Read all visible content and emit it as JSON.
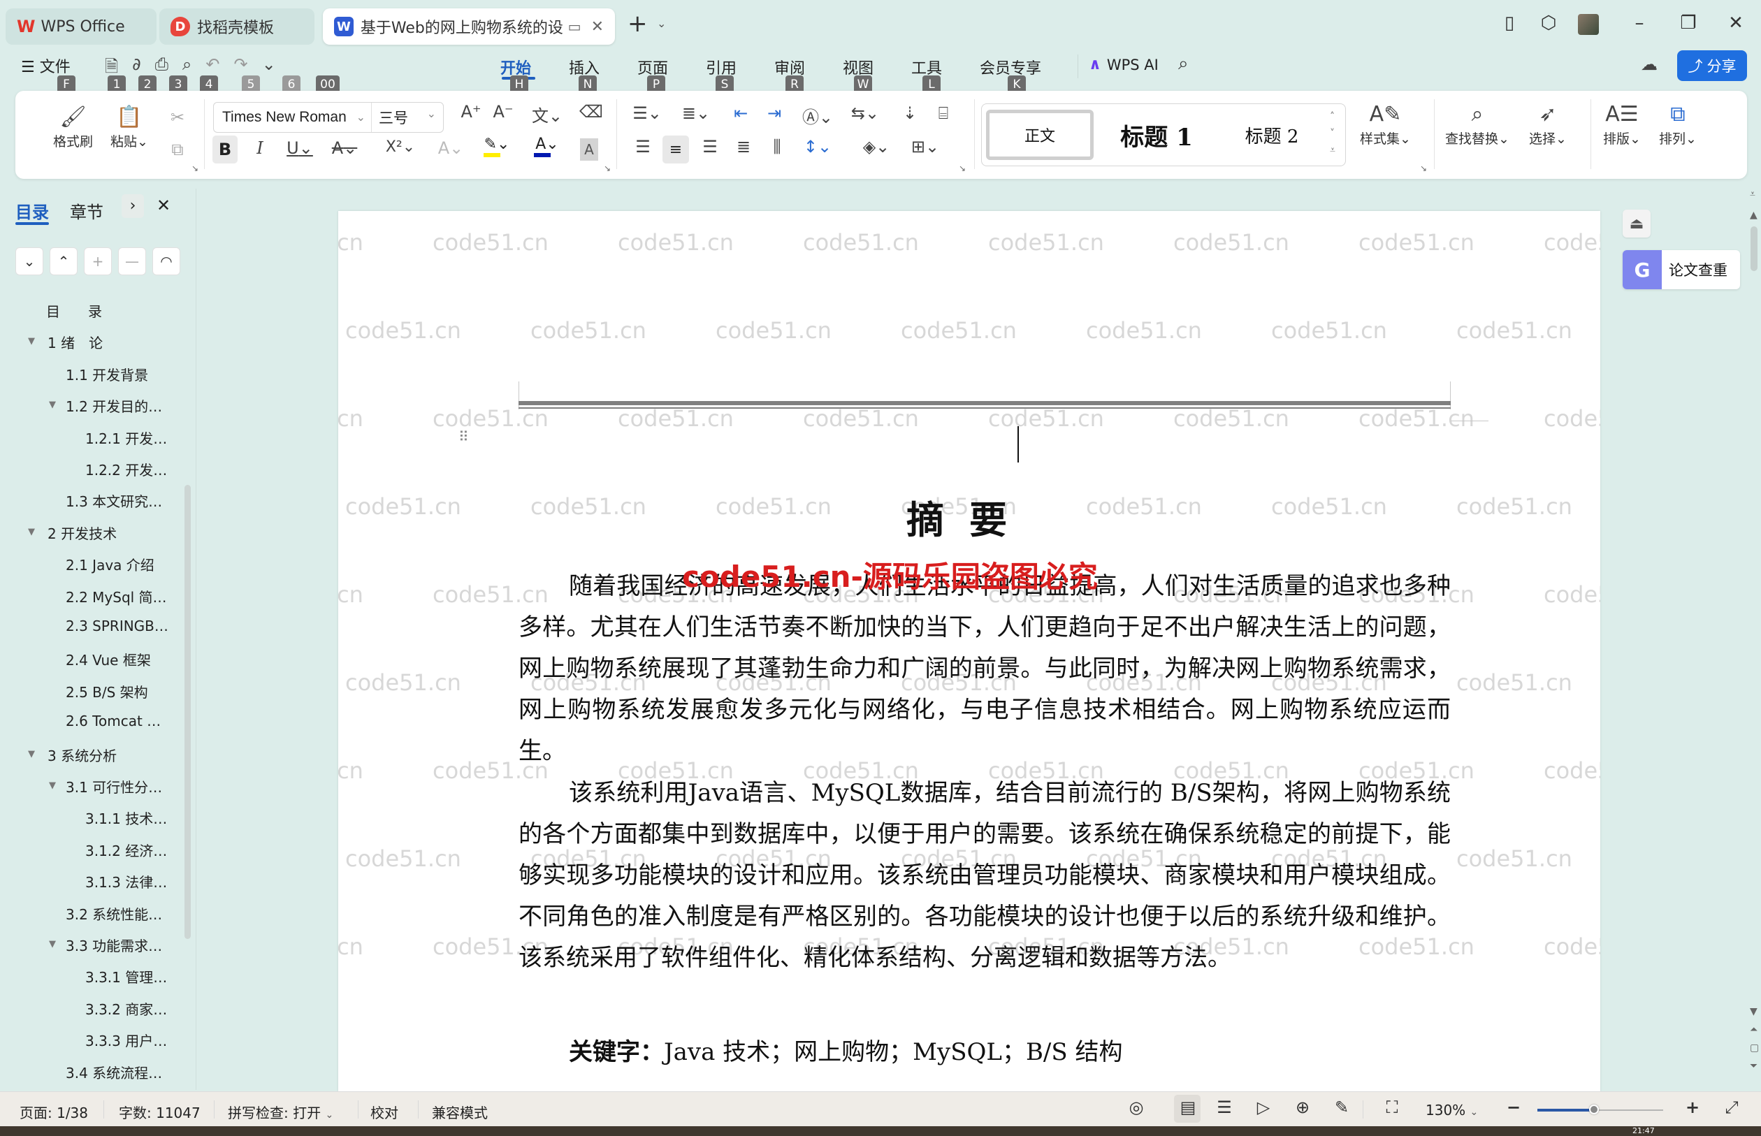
{
  "window": {
    "tabs": [
      {
        "label": "WPS Office",
        "icon": "wps-logo-icon",
        "state": "inactive"
      },
      {
        "label": "找稻壳模板",
        "icon": "docer-logo-icon",
        "state": "inactive"
      },
      {
        "label": "基于Web的网上购物系统的设计",
        "icon": "writer-doc-icon",
        "state": "active"
      }
    ],
    "new_tab_label": "+",
    "controls": [
      "layout-icon",
      "cube-icon",
      "avatar",
      "minimize-icon",
      "restore-icon",
      "close-icon"
    ]
  },
  "menu": {
    "file_label": "文件",
    "file_keytip": "F",
    "quick_keytips": [
      "1",
      "2",
      "3",
      "4",
      "5",
      "6",
      "00"
    ],
    "tabs": [
      {
        "label": "开始",
        "keytip": "H",
        "active": true
      },
      {
        "label": "插入",
        "keytip": "N"
      },
      {
        "label": "页面",
        "keytip": "P"
      },
      {
        "label": "引用",
        "keytip": "S"
      },
      {
        "label": "审阅",
        "keytip": "R"
      },
      {
        "label": "视图",
        "keytip": "W"
      },
      {
        "label": "工具",
        "keytip": "L"
      },
      {
        "label": "会员专享",
        "keytip": "K"
      }
    ],
    "wps_ai_label": "WPS AI",
    "share_label": "分享"
  },
  "ribbon": {
    "format_painter": "格式刷",
    "paste": "粘贴",
    "font_name": "Times New Roman",
    "font_size": "三号",
    "styles": [
      "正文",
      "标题 1",
      "标题 2"
    ],
    "style_set": "样式集",
    "find_replace": "查找替换",
    "select": "选择",
    "layout": "排版",
    "arrange": "排列",
    "bold": "B",
    "italic": "I",
    "underline": "U",
    "strike": "A",
    "superscript": "X²",
    "highlight_color": "#ffee00",
    "font_color": "#0018b0"
  },
  "sidebar": {
    "tabs": [
      {
        "label": "目录",
        "active": true
      },
      {
        "label": "章节"
      }
    ],
    "toc": [
      {
        "label": "目　　录",
        "level": 0,
        "caret": false
      },
      {
        "label": "1 绪　论",
        "level": 0,
        "caret": true
      },
      {
        "label": "1.1 开发背景",
        "level": 1,
        "caret": false
      },
      {
        "label": "1.2 开发目的…",
        "level": 1,
        "caret": true
      },
      {
        "label": "1.2.1 开发…",
        "level": 2,
        "caret": false
      },
      {
        "label": "1.2.2 开发…",
        "level": 2,
        "caret": false
      },
      {
        "label": "1.3 本文研究…",
        "level": 1,
        "caret": false
      },
      {
        "label": "2 开发技术",
        "level": 0,
        "caret": true
      },
      {
        "label": "2.1 Java 介绍",
        "level": 1,
        "caret": false
      },
      {
        "label": "2.2 MySql 简…",
        "level": 1,
        "caret": false
      },
      {
        "label": "2.3 SPRINGB…",
        "level": 1,
        "caret": false
      },
      {
        "label": "2.4 Vue 框架",
        "level": 1,
        "caret": false
      },
      {
        "label": "2.5 B/S 架构",
        "level": 1,
        "caret": false
      },
      {
        "label": "2.6 Tomcat …",
        "level": 1,
        "caret": false
      },
      {
        "label": "3 系统分析",
        "level": 0,
        "caret": true
      },
      {
        "label": "3.1 可行性分…",
        "level": 1,
        "caret": true
      },
      {
        "label": "3.1.1 技术…",
        "level": 2,
        "caret": false
      },
      {
        "label": "3.1.2 经济…",
        "level": 2,
        "caret": false
      },
      {
        "label": "3.1.3 法律…",
        "level": 2,
        "caret": false
      },
      {
        "label": "3.2 系统性能…",
        "level": 1,
        "caret": false
      },
      {
        "label": "3.3 功能需求…",
        "level": 1,
        "caret": true
      },
      {
        "label": "3.3.1 管理…",
        "level": 2,
        "caret": false
      },
      {
        "label": "3.3.2 商家…",
        "level": 2,
        "caret": false
      },
      {
        "label": "3.3.3 用户…",
        "level": 2,
        "caret": false
      },
      {
        "label": "3.4 系统流程…",
        "level": 1,
        "caret": false
      }
    ]
  },
  "document": {
    "title": "摘要",
    "paragraphs": [
      "随着我国经济的高速发展，人们生活水平的日益提高，人们对生活质量的追求也多种多样。尤其在人们生活节奏不断加快的当下，人们更趋向于足不出户解决生活上的问题，网上购物系统展现了其蓬勃生命力和广阔的前景。与此同时，为解决网上购物系统需求，网上购物系统发展愈发多元化与网络化，与电子信息技术相结合。网上购物系统应运而生。",
      "该系统利用Java语言、MySQL数据库，结合目前流行的 B/S架构，将网上购物系统的各个方面都集中到数据库中，以便于用户的需要。该系统在确保系统稳定的前提下，能够实现多功能模块的设计和应用。该系统由管理员功能模块、商家模块和用户模块组成。不同角色的准入制度是有严格区别的。各功能模块的设计也便于以后的系统升级和维护。该系统采用了软件组件化、精化体系结构、分离逻辑和数据等方法。"
    ],
    "keywords_label": "关键字：",
    "keywords": "Java 技术；网上购物；MySQL；B/S 结构",
    "overlay_text": "code51.cn-源码乐园盗图必究",
    "watermark": "code51.cn"
  },
  "right_panel": {
    "paper_check_label": "论文查重"
  },
  "statusbar": {
    "page": "页面: 1/38",
    "words": "字数: 11047",
    "spellcheck": "拼写检查: 打开",
    "proofread": "校对",
    "compat_mode": "兼容模式",
    "zoom_level": "130%",
    "zoom_fraction": 0.45
  },
  "taskbar": {
    "clock": "21:47"
  }
}
